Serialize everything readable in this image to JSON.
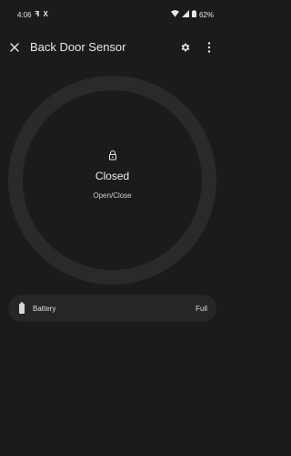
{
  "status_bar": {
    "time": "4:06",
    "app_icon_1": "ꟻ",
    "app_icon_2": "X",
    "battery_percent": "62%",
    "icons": [
      "notification-n-icon",
      "x-logo-icon",
      "wifi-icon",
      "cell-signal-icon",
      "battery-icon"
    ]
  },
  "header": {
    "title": "Back Door Sensor",
    "close_icon": "close-icon",
    "settings_icon": "gear-icon",
    "more_icon": "more-vert-icon"
  },
  "dial": {
    "icon": "lock-icon",
    "state": "Closed",
    "label": "Open/Close"
  },
  "battery": {
    "icon": "battery-icon",
    "label": "Battery",
    "value": "Full"
  },
  "colors": {
    "background": "#1b1b1b",
    "ring": "#2a2a2a",
    "card": "#262626",
    "text": "#e3e3e3"
  }
}
